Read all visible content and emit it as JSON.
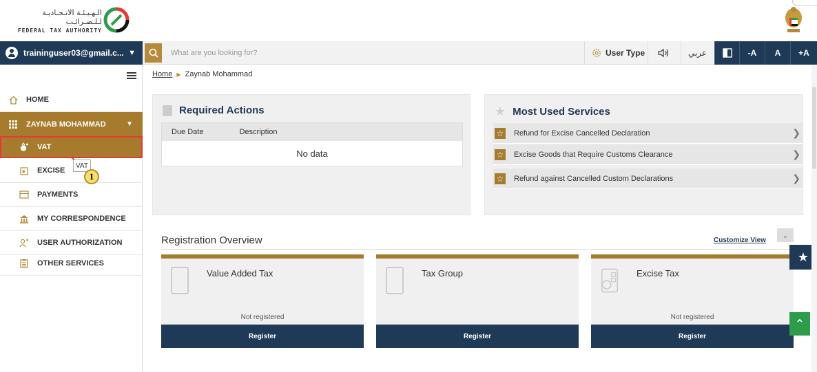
{
  "brand": {
    "name_ar": "الـهـيـئـة الاتـحـاديـة لـلـضـرائـب",
    "name_en": "FEDERAL TAX AUTHORITY"
  },
  "topbar": {
    "user_email": "traininguser03@gmail.c...",
    "search_placeholder": "What are you looking for?",
    "user_type_label": "User Type",
    "language_toggle": "عربي",
    "font_decrease": "-A",
    "font_normal": "A",
    "font_increase": "+A"
  },
  "sidebar": {
    "items": [
      {
        "label": "HOME",
        "icon": "home-icon"
      },
      {
        "label": "ZAYNAB MOHAMMAD",
        "icon": "grid-icon"
      },
      {
        "label": "VAT",
        "icon": "money-bag-icon"
      },
      {
        "label": "EXCISE",
        "icon": "excise-icon"
      },
      {
        "label": "PAYMENTS",
        "icon": "payment-card-icon"
      },
      {
        "label": "MY CORRESPONDENCE",
        "icon": "bank-icon"
      },
      {
        "label": "USER AUTHORIZATION",
        "icon": "user-key-icon"
      },
      {
        "label": "OTHER SERVICES",
        "icon": "clipboard-icon"
      }
    ],
    "tooltip": "VAT",
    "step_number": "1"
  },
  "breadcrumb": {
    "home": "Home",
    "current": "Zaynab Mohammad"
  },
  "required_actions": {
    "title": "Required Actions",
    "columns": [
      "Due Date",
      "Description"
    ],
    "empty_text": "No data"
  },
  "most_used": {
    "title": "Most Used Services",
    "items": [
      "Refund for Excise Cancelled Declaration",
      "Excise Goods that Require Customs Clearance",
      "Refund against Cancelled Custom Declarations"
    ]
  },
  "registration": {
    "title": "Registration Overview",
    "customize": "Customize View",
    "cards": [
      {
        "title": "Value Added Tax",
        "status": "Not registered",
        "button": "Register"
      },
      {
        "title": "Tax Group",
        "status": "",
        "button": "Register"
      },
      {
        "title": "Excise Tax",
        "status": "Not registered",
        "button": "Register"
      }
    ]
  },
  "colors": {
    "navy": "#1f3a56",
    "gold": "#a77b2e",
    "green": "#2e9c4a",
    "highlight_red": "#e53935"
  }
}
